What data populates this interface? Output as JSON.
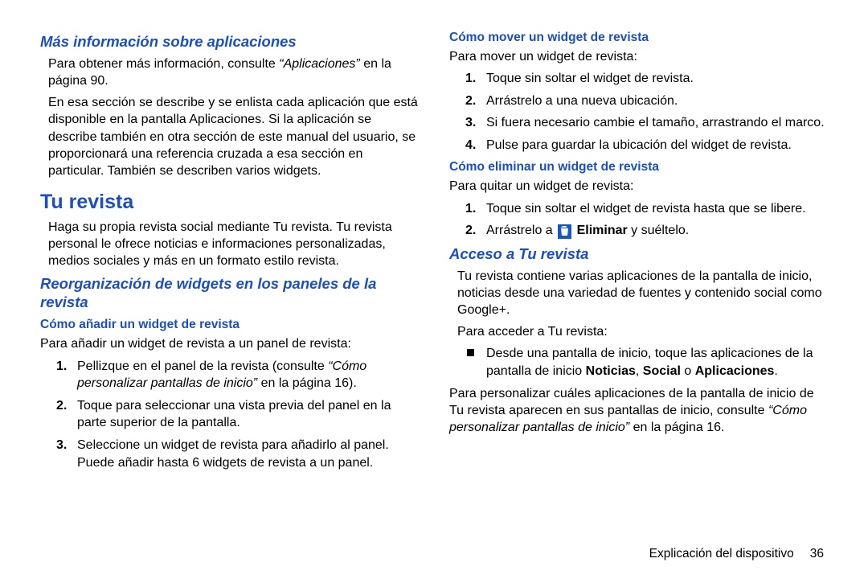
{
  "left": {
    "h1": "Más información sobre aplicaciones",
    "p1a": "Para obtener más información, consulte ",
    "p1ref": "“Aplicaciones” ",
    "p1b": " en la página 90.",
    "p2": "En esa sección se describe y se enlista cada aplicación que está disponible en la pantalla Aplicaciones. Si la aplicación se describe también en otra sección de este manual del usuario, se proporcionará una referencia cruzada a esa sección en particular. También se describen varios widgets.",
    "h2": "Tu revista",
    "p3": "Haga su propia revista social mediante Tu revista. Tu revista personal le ofrece noticias e informaciones personalizadas, medios sociales y más en un formato estilo revista.",
    "h3": "Reorganización de widgets en los paneles de la revista",
    "h4": "Cómo añadir un widget de revista",
    "p4": "Para añadir un widget de revista a un panel de revista:",
    "ol": [
      {
        "n": "1.",
        "a": "Pellizque en el panel de la revista (consulte ",
        "ref": "“Cómo personalizar pantallas de inicio”",
        "b": " en la página 16)."
      },
      {
        "n": "2.",
        "t": "Toque para seleccionar una vista previa del panel en la parte superior de la pantalla."
      },
      {
        "n": "3.",
        "t": "Seleccione un widget de revista para añadirlo al panel. Puede añadir hasta 6 widgets de revista a un panel."
      }
    ]
  },
  "right": {
    "h5": "Cómo mover un widget de revista",
    "p5": "Para mover un widget de revista:",
    "ol2": [
      {
        "n": "1.",
        "t": "Toque sin soltar el widget de revista."
      },
      {
        "n": "2.",
        "t": "Arrástrelo a una nueva ubicación."
      },
      {
        "n": "3.",
        "t": "Si fuera necesario cambie el tamaño, arrastrando el marco."
      },
      {
        "n": "4.",
        "t": "Pulse para guardar la ubicación del widget de revista."
      }
    ],
    "h6": "Cómo eliminar un widget de revista",
    "p6": "Para quitar un widget de revista:",
    "ol3_1n": "1.",
    "ol3_1t": "Toque sin soltar el widget de revista hasta que se libere.",
    "ol3_2n": "2.",
    "ol3_2a": "Arrástrelo a ",
    "ol3_2bold": "Eliminar",
    "ol3_2b": " y suéltelo.",
    "h7": "Acceso a Tu revista",
    "p7": "Tu revista contiene varias aplicaciones de la pantalla de inicio, noticias desde una variedad de fuentes y contenido social como Google+.",
    "p8": "Para acceder a Tu revista:",
    "bullet_a": "Desde una pantalla de inicio, toque las aplicaciones de la pantalla de inicio ",
    "bullet_b1": "Noticias",
    "bullet_c1": ", ",
    "bullet_b2": "Social",
    "bullet_c2": " o ",
    "bullet_b3": "Aplicaciones",
    "bullet_c3": ".",
    "p9a": "Para personalizar cuáles aplicaciones de la pantalla de inicio de Tu revista aparecen en sus pantallas de inicio, consulte ",
    "p9ref": "“Cómo personalizar pantallas de inicio”",
    "p9b": " en la página 16."
  },
  "footer": {
    "label": "Explicación del dispositivo",
    "page": "36"
  }
}
